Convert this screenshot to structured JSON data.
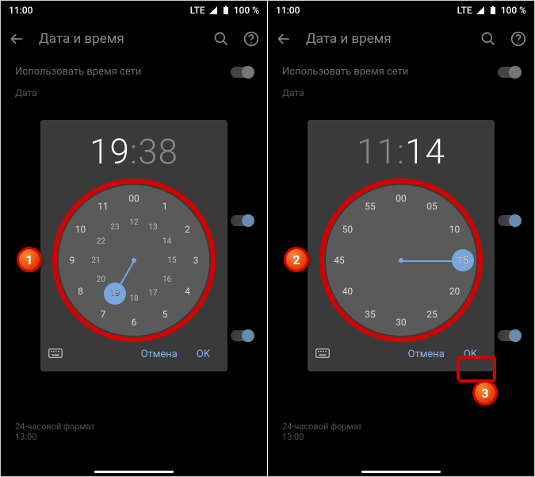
{
  "status": {
    "time": "11:00",
    "lte": "LTE",
    "battery": "100 %"
  },
  "appbar": {
    "title": "Дата и время"
  },
  "rows": {
    "net_time": "Использовать время сети",
    "date": "Дата",
    "format24": "24-часовой формат",
    "format_sub": "13:00"
  },
  "left": {
    "hour": "19",
    "minute": "38",
    "outer": [
      "00",
      "1",
      "2",
      "3",
      "4",
      "5",
      "6",
      "7",
      "8",
      "9",
      "10",
      "11"
    ],
    "inner": [
      "12",
      "13",
      "14",
      "15",
      "16",
      "17",
      "18",
      "19",
      "20",
      "21",
      "22",
      "23"
    ],
    "selected": "19",
    "cancel": "Отмена",
    "ok": "OK",
    "annotation": "1"
  },
  "right": {
    "hour": "11",
    "minute": "14",
    "outer": [
      "00",
      "05",
      "10",
      "15",
      "20",
      "25",
      "30",
      "35",
      "40",
      "45",
      "50",
      "55"
    ],
    "selected": "15",
    "cancel": "Отмена",
    "ok": "OK",
    "annotation_dial": "2",
    "annotation_ok": "3"
  }
}
